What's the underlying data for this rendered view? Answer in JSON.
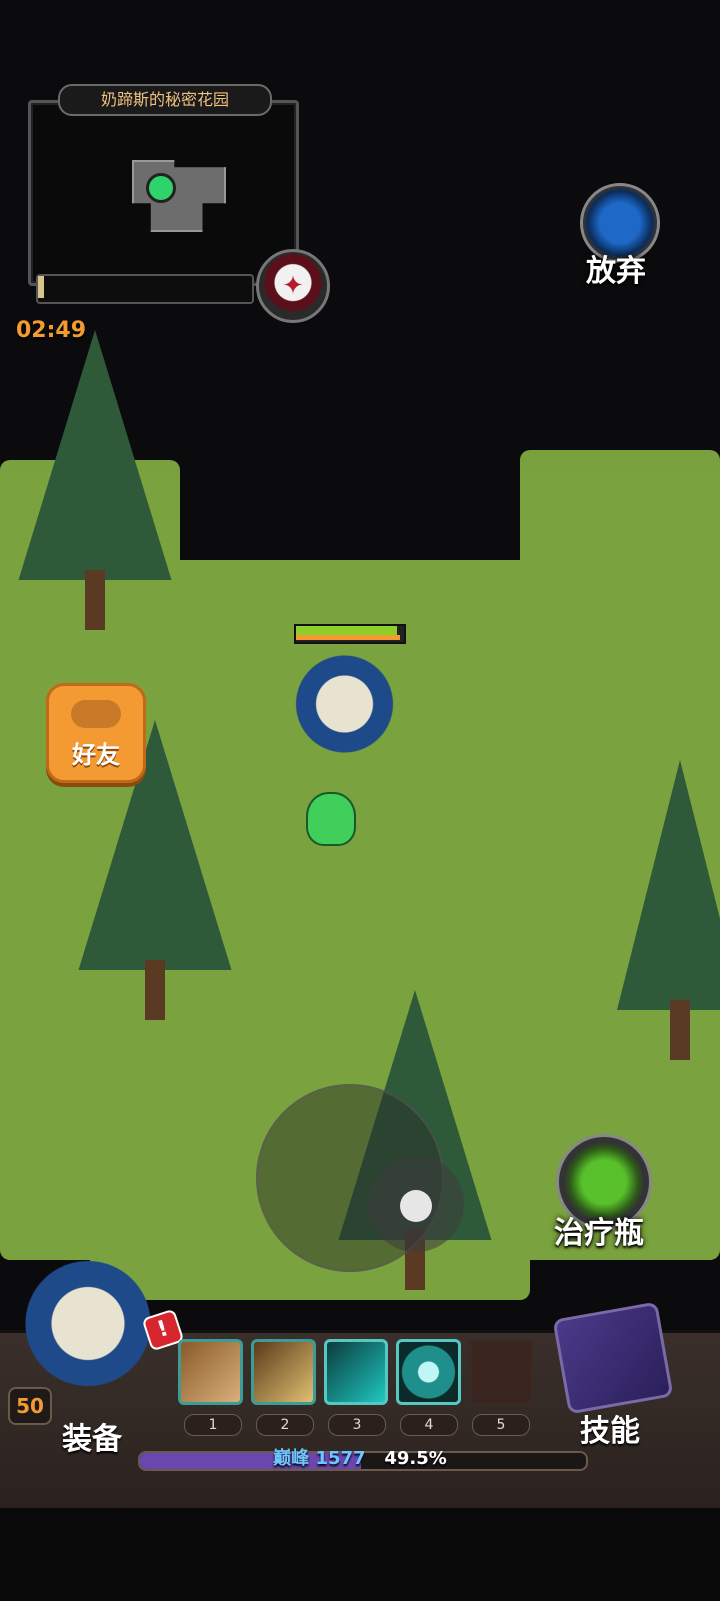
{
  "map": {
    "title": "奶蹄斯的秘密花园",
    "timer": "02:49",
    "progress_fraction": 0.03
  },
  "buttons": {
    "quit_label": "放弃",
    "friends_label": "好友",
    "potion_label": "治疗瓶",
    "equip_label": "装备",
    "skills_label": "技能"
  },
  "player": {
    "level": "50",
    "hp_fraction": 0.97
  },
  "skills": {
    "slots": [
      {
        "number": "1",
        "icon": "earth-skill-icon"
      },
      {
        "number": "2",
        "icon": "moon-skill-icon"
      },
      {
        "number": "3",
        "icon": "lightning-skill-icon"
      },
      {
        "number": "4",
        "icon": "spirit-orb-skill-icon"
      },
      {
        "number": "5",
        "icon": "empty-slot"
      }
    ]
  },
  "xp": {
    "peak_label": "巅峰",
    "peak_level": "1577",
    "percent_text": "49.5%",
    "fraction": 0.495
  },
  "alert": {
    "text": "!"
  },
  "colors": {
    "accent_orange": "#f39b32",
    "grass": "#7aa23e",
    "xp_fill": "#6b46b0",
    "hp_green": "#8dcf2a"
  }
}
